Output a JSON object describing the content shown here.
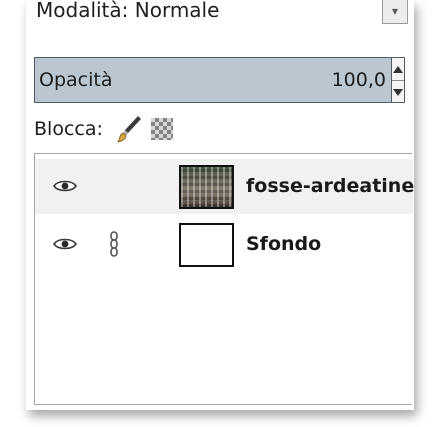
{
  "mode": {
    "label": "Modalità: Normale"
  },
  "opacity": {
    "label": "Opacità",
    "value": "100,0"
  },
  "lock": {
    "label": "Blocca:"
  },
  "layers": [
    {
      "name": "fosse-ardeatine",
      "visible": true,
      "linked": false,
      "selected": true
    },
    {
      "name": "Sfondo",
      "visible": true,
      "linked": true,
      "selected": false
    }
  ],
  "icons": {
    "eye": "eye-icon",
    "chain": "chain-link-icon",
    "brush": "paintbrush-icon",
    "alpha": "checkerboard-icon"
  },
  "colors": {
    "opacity_bg": "#bac7d1",
    "selected_row_bg": "#f1f1f1"
  }
}
